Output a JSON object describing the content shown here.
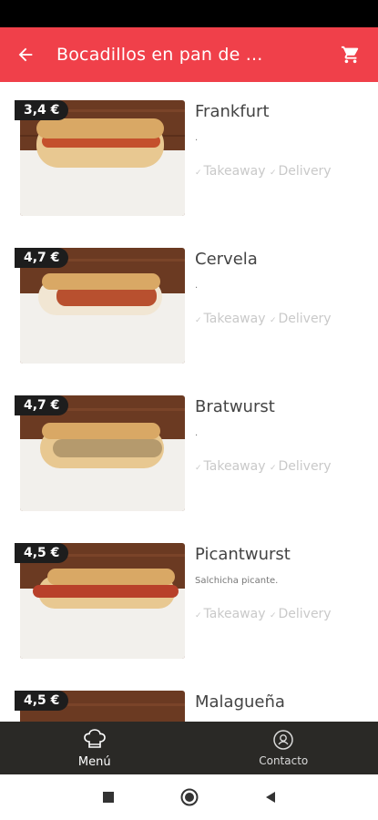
{
  "header": {
    "title": "Bocadillos en pan de ..."
  },
  "items": [
    {
      "price": "3,4 €",
      "name": "Frankfurt",
      "desc": ".",
      "opt_takeaway": "Takeaway",
      "opt_delivery": "Delivery",
      "sausage_color": "#c4502c"
    },
    {
      "price": "4,7 €",
      "name": "Cervela",
      "desc": ".",
      "opt_takeaway": "Takeaway",
      "opt_delivery": "Delivery",
      "sausage_color": "#b8502f"
    },
    {
      "price": "4,7 €",
      "name": "Bratwurst",
      "desc": ".",
      "opt_takeaway": "Takeaway",
      "opt_delivery": "Delivery",
      "sausage_color": "#b59a6d"
    },
    {
      "price": "4,5 €",
      "name": "Picantwurst",
      "desc": "Salchicha picante.",
      "opt_takeaway": "Takeaway",
      "opt_delivery": "Delivery",
      "sausage_color": "#b8402a"
    },
    {
      "price": "4,5 €",
      "name": "Malagueña",
      "desc": "",
      "opt_takeaway": "",
      "opt_delivery": "",
      "sausage_color": "#b8502f"
    }
  ],
  "bottom_nav": {
    "menu_label": "Menú",
    "contact_label": "Contacto"
  },
  "colors": {
    "accent": "#f0404a",
    "nav_bg": "#2a2926",
    "price_bg": "#1d1d1d"
  }
}
